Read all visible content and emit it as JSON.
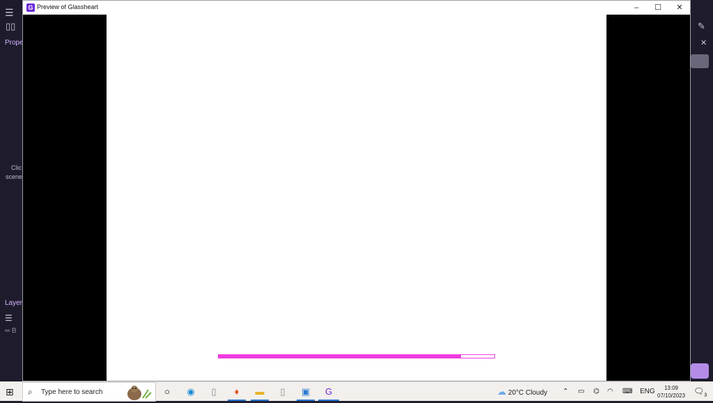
{
  "background_app": {
    "left_panel": {
      "properties_label": "Prope",
      "hint_line1": "Clic",
      "hint_line2": "scene",
      "layers_label": "Layer",
      "layer_item": "B"
    }
  },
  "window": {
    "title": "Preview of Glassheart",
    "controls": {
      "minimize": "–",
      "maximize": "☐",
      "close": "✕"
    },
    "progress_percent": 88
  },
  "taskbar": {
    "search_placeholder": "Type here to search",
    "weather": {
      "temp": "20°C",
      "condition": "Cloudy"
    },
    "language": "ENG",
    "time": "13:09",
    "date": "07/10/2023",
    "notification_count": "3"
  },
  "colors": {
    "accent": "#f03be0",
    "app_purple": "#6a2bd9"
  }
}
